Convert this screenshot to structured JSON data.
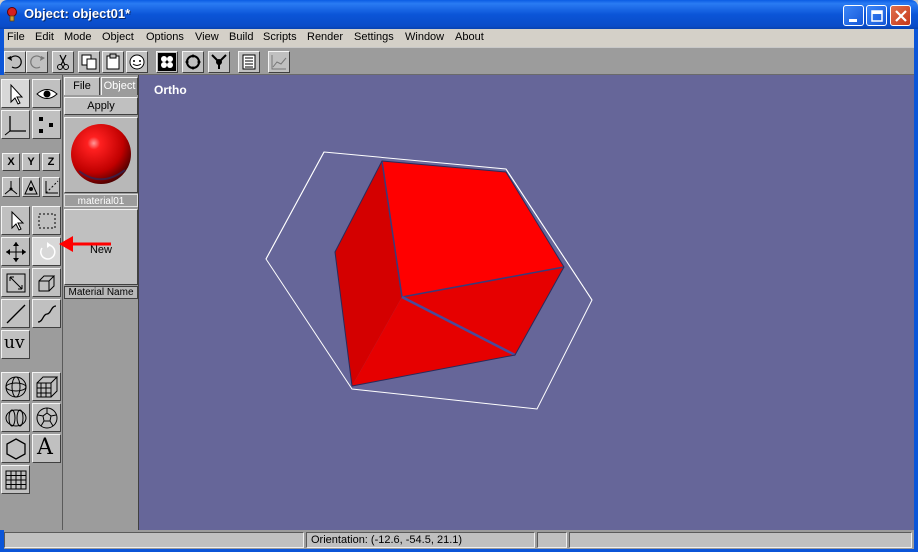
{
  "window": {
    "title": "Object: object01*",
    "buttons": [
      "minimize",
      "maximize",
      "close"
    ]
  },
  "menu": [
    "File",
    "Edit",
    "Mode",
    "Object",
    "Options",
    "View",
    "Build",
    "Scripts",
    "Render",
    "Settings",
    "Window",
    "About"
  ],
  "toolbar": {
    "icons": [
      "undo-icon",
      "redo-icon",
      "cut-icon",
      "copy-icon",
      "paste-icon",
      "clear-icon",
      "points-icon",
      "edges-icon",
      "faces-icon",
      "list-icon",
      "graph-icon"
    ]
  },
  "toolbox": {
    "axes": [
      "X",
      "Y",
      "Z"
    ],
    "uv_label": "uv",
    "text_tool_label": "A"
  },
  "material_panel": {
    "tabs": [
      "File",
      "Object"
    ],
    "apply_label": "Apply",
    "material_label": "material01",
    "new_label": "New",
    "name_label": "Material Name"
  },
  "viewport": {
    "label": "Ortho",
    "background": "#666699",
    "object_color": "#ee0000"
  },
  "status": {
    "orientation": "Orientation: (-12.6, -54.5, 21.1)"
  },
  "colors": {
    "titlebar": "#0b55d8",
    "annotation_arrow": "#ff0000"
  }
}
